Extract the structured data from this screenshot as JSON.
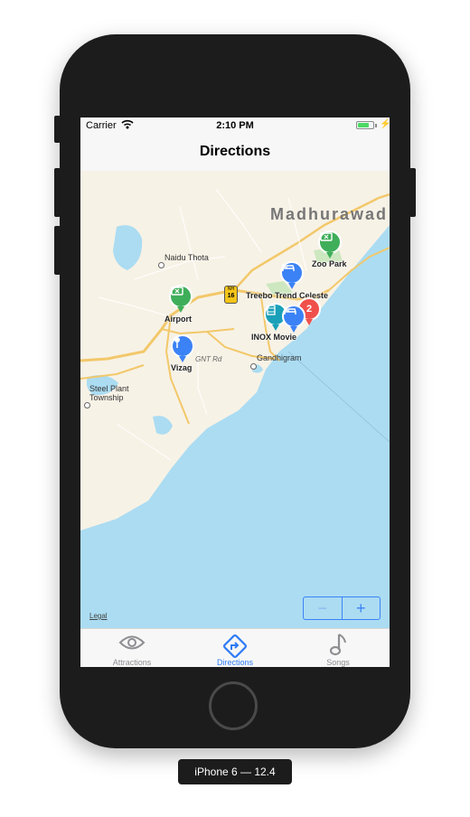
{
  "status_bar": {
    "carrier": "Carrier",
    "time": "2:10 PM",
    "battery_level": 0.75
  },
  "nav_bar": {
    "title": "Directions"
  },
  "map": {
    "labels": {
      "madhurawada": "Madhurawad",
      "naidu_thota": "Naidu Thota",
      "zoo_park": "Zoo Park",
      "treebo": "Treebo Trend Celeste",
      "airport": "Airport",
      "inox": "INOX Movie",
      "vizag": "Vizag",
      "gnt_rd": "GNT Rd",
      "gandhigram": "Gandhigram",
      "steel_plant": "Steel Plant",
      "township": "Township",
      "nh": "NH",
      "nh_number": "16"
    },
    "cluster_count": "2",
    "legal": "Legal",
    "zoom_out": "−",
    "zoom_in": "+"
  },
  "tabs": [
    {
      "label": "Attractions",
      "icon": "eye-icon",
      "active": false
    },
    {
      "label": "Directions",
      "icon": "directions-icon",
      "active": true
    },
    {
      "label": "Songs",
      "icon": "music-note-icon",
      "active": false
    }
  ],
  "device_label": "iPhone 6 — 12.4",
  "colors": {
    "accent": "#2f7cf6",
    "water": "#abdcf2",
    "land": "#f7f2e6",
    "pin_green": "#3fae5a",
    "pin_blue": "#3b82f6",
    "pin_teal": "#1aa0b8",
    "pin_red": "#f0504b"
  }
}
